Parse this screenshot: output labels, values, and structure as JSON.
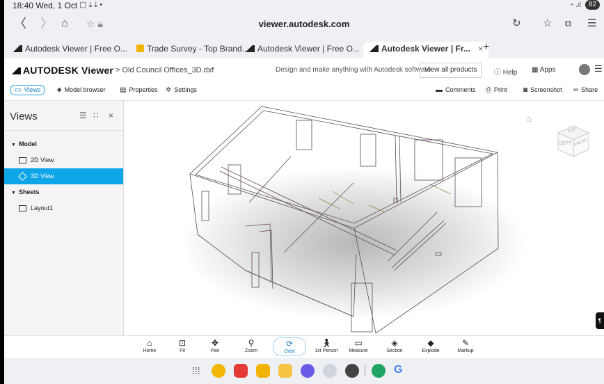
{
  "status_bar": {
    "time": "18:40 Wed, 1 Oct",
    "battery": "82"
  },
  "browser": {
    "url": "viewer.autodesk.com",
    "tabs": [
      {
        "label": "Autodesk Viewer | Free O..."
      },
      {
        "label": "Trade Survey - Top Brand..."
      },
      {
        "label": "Autodesk Viewer | Free O..."
      },
      {
        "label": "Autodesk Viewer | Fr..."
      }
    ],
    "new_tab": "+"
  },
  "header": {
    "logo": "AUTODESK Viewer",
    "breadcrumb": "Old Council Offices_3D.dxf",
    "tagline": "Design and make anything with Autodesk software",
    "view_all": "View all products",
    "help": "Help",
    "apps": "Apps"
  },
  "toolbar": {
    "views": "Views",
    "model_browser": "Model browser",
    "properties": "Properties",
    "settings": "Settings",
    "comments": "Comments",
    "print": "Print",
    "screenshot": "Screenshot",
    "share": "Share"
  },
  "views_panel": {
    "title": "Views",
    "sections": [
      {
        "label": "Model",
        "items": [
          {
            "label": "2D View",
            "selected": false
          },
          {
            "label": "3D View",
            "selected": true
          }
        ]
      },
      {
        "label": "Sheets",
        "items": [
          {
            "label": "Layout1",
            "selected": false
          }
        ]
      }
    ]
  },
  "viewcube": {
    "left": "LEFT",
    "front": "FRONT",
    "top": "TOP"
  },
  "bottom_tools": [
    {
      "label": "Home",
      "icon": "home-icon",
      "active": false
    },
    {
      "label": "Fit",
      "icon": "fit-icon",
      "active": false
    },
    {
      "label": "Pan",
      "icon": "pan-icon",
      "active": false
    },
    {
      "label": "Zoom",
      "icon": "zoom-icon",
      "active": false
    },
    {
      "label": "Orbit",
      "icon": "orbit-icon",
      "active": true
    },
    {
      "label": "1st Person",
      "icon": "person-icon",
      "active": false
    },
    {
      "label": "Measure",
      "icon": "measure-icon",
      "active": false
    },
    {
      "label": "Section",
      "icon": "section-icon",
      "active": false
    },
    {
      "label": "Explode",
      "icon": "explode-icon",
      "active": false
    },
    {
      "label": "Markup",
      "icon": "markup-icon",
      "active": false
    }
  ],
  "colors": {
    "accent": "#0ea5e9",
    "active_text": "#1b7fc4"
  }
}
